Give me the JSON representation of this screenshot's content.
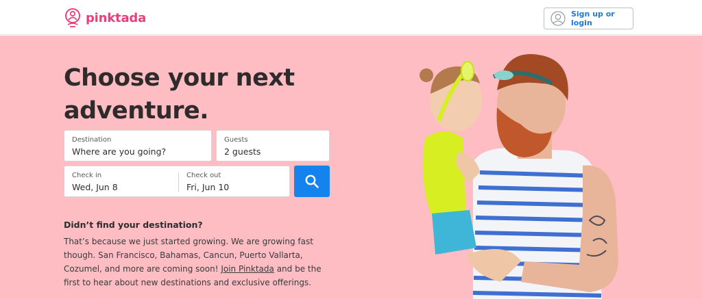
{
  "header": {
    "brand": "pinktada",
    "login_label": "Sign up or login"
  },
  "hero": {
    "headline": "Choose your next adventure.",
    "search": {
      "destination_label": "Destination",
      "destination_value": "Where are you going?",
      "guests_label": "Guests",
      "guests_value": "2 guests",
      "checkin_label": "Check in",
      "checkin_value": "Wed, Jun 8",
      "checkout_label": "Check out",
      "checkout_value": "Fri, Jun 10"
    },
    "info": {
      "title": "Didn’t find your destination?",
      "body_before": "That’s because we just started growing. We are growing fast though. San Francisco, Bahamas, Cancun, Puerto Vallarta, Cozumel, and more are coming soon! ",
      "link": "Join Pinktada",
      "body_after": " and be the first to hear about new destinations and exclusive offerings."
    }
  },
  "colors": {
    "brand": "#e9407a",
    "hero_bg": "#fdbdc3",
    "link_blue": "#1e78d6",
    "search_button": "#1583ee"
  },
  "icons": {
    "logo": "pinktada-logo-icon",
    "login": "user-avatar-icon",
    "search": "search-icon"
  }
}
